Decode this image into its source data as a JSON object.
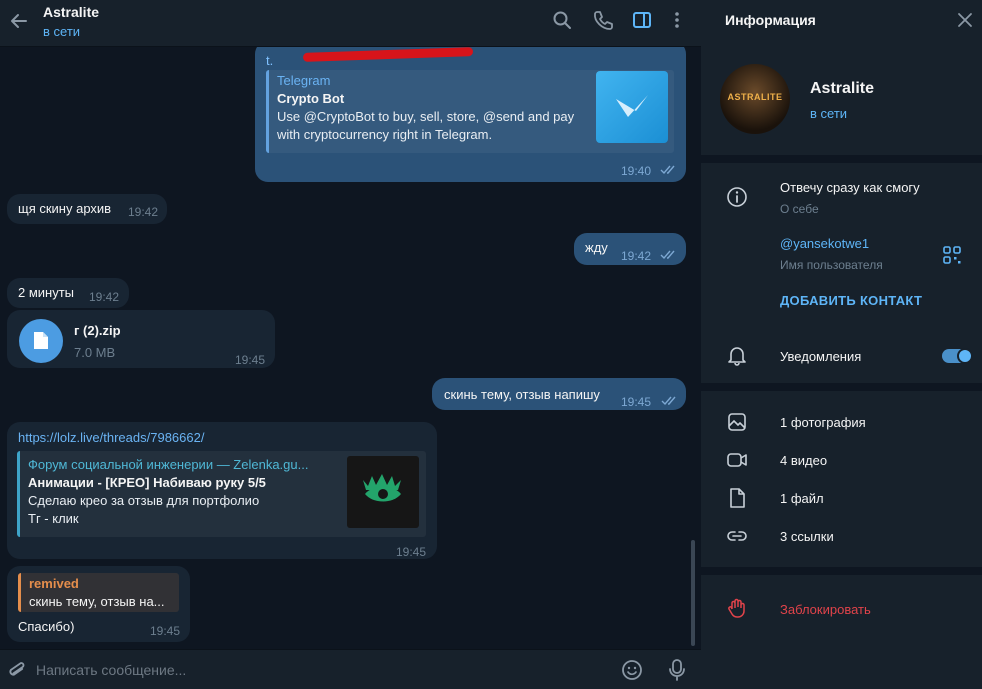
{
  "chat": {
    "title": "Astralite",
    "status": "в сети",
    "composer_placeholder": "Написать сообщение..."
  },
  "messages": {
    "m1": {
      "link": "t.",
      "site": "Telegram",
      "title": "Crypto Bot",
      "desc1": "Use @CryptoBot to buy, sell, store, @send and pay",
      "desc2": "with cryptocurrency right in Telegram.",
      "time": "19:40"
    },
    "m2": {
      "text": "щя скину архив",
      "time": "19:42"
    },
    "m3": {
      "text": "жду",
      "time": "19:42"
    },
    "m4": {
      "text": "2 минуты",
      "time": "19:42"
    },
    "m5": {
      "file_name": "г (2).zip",
      "file_size": "7.0 MB",
      "time": "19:45"
    },
    "m6": {
      "text": "скинь тему, отзыв напишу",
      "time": "19:45"
    },
    "m7": {
      "link": "https://lolz.live/threads/7986662/",
      "site": "Форум социальной инженерии — Zelenka.gu...",
      "title": "Анимации - [КРЕО] Набиваю руку 5/5",
      "desc1": "Сделаю крео за отзыв для портфолио",
      "desc2": "Тг - клик",
      "time": "19:45"
    },
    "m8": {
      "reply_name": "remived",
      "reply_text": "скинь тему, отзыв на...",
      "text": "Спасибо)",
      "time": "19:45"
    }
  },
  "info": {
    "header": "Информация",
    "name": "Astralite",
    "status": "в сети",
    "avatar_text": "ASTRALITE",
    "bio": "Отвечу сразу как смогу",
    "bio_label": "О себе",
    "username": "@yansekotwe1",
    "username_label": "Имя пользователя",
    "add_contact": "ДОБАВИТЬ КОНТАКТ",
    "notifications": "Уведомления",
    "notifications_on": true,
    "media": {
      "photos": "1 фотография",
      "videos": "4 видео",
      "files": "1 файл",
      "links": "3 ссылки"
    },
    "block": "Заблокировать"
  },
  "colors": {
    "accent": "#5eb5f7",
    "outgoing": "#2b5278",
    "incoming": "#182533",
    "danger": "#e0434a",
    "reply_name": "#e58e4c"
  }
}
